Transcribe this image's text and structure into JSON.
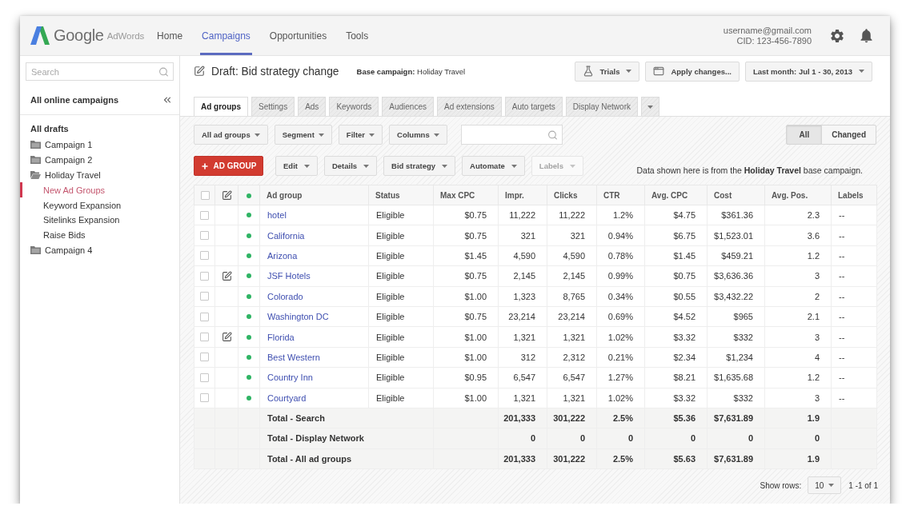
{
  "header": {
    "logo": {
      "name": "Google",
      "product": "AdWords"
    },
    "nav": [
      {
        "label": "Home",
        "selected": false
      },
      {
        "label": "Campaigns",
        "selected": true
      },
      {
        "label": "Opportunities",
        "selected": false
      },
      {
        "label": "Tools",
        "selected": false
      }
    ],
    "account": {
      "email": "username@gmail.com",
      "cid": "CID: 123-456-7890"
    }
  },
  "sidebar": {
    "search": {
      "placeholder": "Search"
    },
    "title": "All online campaigns",
    "heading": "All drafts",
    "tree": [
      {
        "label": "Campaign 1",
        "expanded": false,
        "selected": false
      },
      {
        "label": "Campaign 2",
        "expanded": false,
        "selected": false
      },
      {
        "label": "Holiday Travel",
        "expanded": true,
        "selected": false,
        "children": [
          {
            "label": "New Ad Groups",
            "selected": true
          },
          {
            "label": "Keyword Expansion",
            "selected": false
          },
          {
            "label": "Sitelinks Expansion",
            "selected": false
          },
          {
            "label": "Raise Bids",
            "selected": false
          }
        ]
      },
      {
        "label": "Campaign 4",
        "expanded": false,
        "selected": false
      }
    ]
  },
  "draft": {
    "title": "Draft: Bid strategy change",
    "base_campaign": "**Base campaign:** Holiday Travel",
    "actions": [
      {
        "kind": "trials",
        "label": "Trials"
      },
      {
        "kind": "apply",
        "label": "Apply changes..."
      },
      {
        "kind": "range",
        "label": "Last month: Jul 1 - 30, 2013"
      }
    ]
  },
  "tabs": [
    {
      "label": "Ad groups",
      "selected": true
    },
    {
      "label": "Settings",
      "selected": false
    },
    {
      "label": "Ads",
      "selected": false
    },
    {
      "label": "Keywords",
      "selected": false
    },
    {
      "label": "Audiences",
      "selected": false
    },
    {
      "label": "Ad extensions",
      "selected": false
    },
    {
      "label": "Auto targets",
      "selected": false
    },
    {
      "label": "Display Network",
      "selected": false
    }
  ],
  "toolbar": {
    "filters": [
      "All ad groups",
      "Segment",
      "Filter",
      "Columns"
    ],
    "view": [
      {
        "label": "All",
        "selected": true
      },
      {
        "label": "Changed",
        "selected": false
      }
    ],
    "add_button": "AD GROUP",
    "menus": [
      {
        "label": "Edit",
        "disabled": false
      },
      {
        "label": "Details",
        "disabled": false
      },
      {
        "label": "Bid strategy",
        "disabled": false
      },
      {
        "label": "Automate",
        "disabled": false
      },
      {
        "label": "Labels",
        "disabled": true
      }
    ],
    "note": "Data shown here is from the **Holiday Travel** base campaign."
  },
  "table": {
    "select_all_checked": false,
    "columns": [
      "Ad group",
      "Status",
      "Max CPC",
      "Impr.",
      "Clicks",
      "CTR",
      "Avg. CPC",
      "Cost",
      "Avg. Pos.",
      "Labels"
    ],
    "rows": [
      {
        "checked": false,
        "edited": false,
        "cells": [
          "hotel",
          "Eligible",
          "$0.75",
          "11,222",
          "11,222",
          "1.2%",
          "$4.75",
          "$361.36",
          "2.3",
          "--"
        ]
      },
      {
        "checked": false,
        "edited": false,
        "cells": [
          "California",
          "Eligible",
          "$0.75",
          "321",
          "321",
          "0.94%",
          "$6.75",
          "$1,523.01",
          "3.6",
          "--"
        ]
      },
      {
        "checked": false,
        "edited": false,
        "cells": [
          "Arizona",
          "Eligible",
          "$1.45",
          "4,590",
          "4,590",
          "0.78%",
          "$1.45",
          "$459.21",
          "1.2",
          "--"
        ]
      },
      {
        "checked": false,
        "edited": true,
        "cells": [
          "JSF Hotels",
          "Eligible",
          "$0.75",
          "2,145",
          "2,145",
          "0.99%",
          "$0.75",
          "$3,636.36",
          "3",
          "--"
        ]
      },
      {
        "checked": false,
        "edited": false,
        "cells": [
          "Colorado",
          "Eligible",
          "$1.00",
          "1,323",
          "8,765",
          "0.34%",
          "$0.55",
          "$3,432.22",
          "2",
          "--"
        ]
      },
      {
        "checked": false,
        "edited": false,
        "cells": [
          "Washington DC",
          "Eligible",
          "$0.75",
          "23,214",
          "23,214",
          "0.69%",
          "$4.52",
          "$965",
          "2.1",
          "--"
        ]
      },
      {
        "checked": false,
        "edited": true,
        "cells": [
          "Florida",
          "Eligible",
          "$1.00",
          "1,321",
          "1,321",
          "1.02%",
          "$3.32",
          "$332",
          "3",
          "--"
        ]
      },
      {
        "checked": false,
        "edited": false,
        "cells": [
          "Best Western",
          "Eligible",
          "$1.00",
          "312",
          "2,312",
          "0.21%",
          "$2.34",
          "$1,234",
          "4",
          "--"
        ]
      },
      {
        "checked": false,
        "edited": false,
        "cells": [
          "Country Inn",
          "Eligible",
          "$0.95",
          "6,547",
          "6,547",
          "1.27%",
          "$8.21",
          "$1,635.68",
          "1.2",
          "--"
        ]
      },
      {
        "checked": false,
        "edited": false,
        "cells": [
          "Courtyard",
          "Eligible",
          "$1.00",
          "1,321",
          "1,321",
          "1.02%",
          "$3.32",
          "$332",
          "3",
          "--"
        ]
      }
    ],
    "totals": [
      {
        "cells": [
          "Total - Search",
          "",
          "",
          "201,333",
          "301,222",
          "2.5%",
          "$5.36",
          "$7,631.89",
          "1.9"
        ]
      },
      {
        "cells": [
          "Total - Display Network",
          "",
          "",
          "0",
          "0",
          "0",
          "0",
          "0",
          "0"
        ]
      },
      {
        "cells": [
          "Total - All ad groups",
          "",
          "",
          "201,333",
          "301,222",
          "2.5%",
          "$5.63",
          "$7,631.89",
          "1.9"
        ]
      }
    ]
  },
  "footer": {
    "show_rows_label": "Show rows:",
    "rows_per_page": "10",
    "range": "1 -1 of 1"
  }
}
